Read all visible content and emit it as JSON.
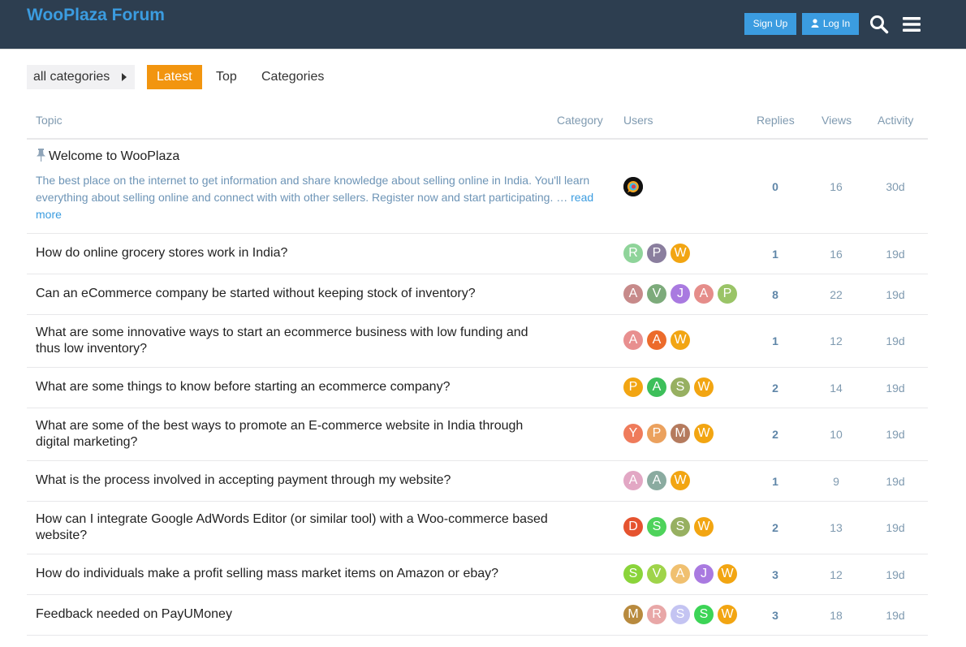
{
  "header": {
    "logo": "WooPlaza Forum",
    "signup_label": "Sign Up",
    "login_label": "Log In"
  },
  "nav": {
    "category_dropdown": "all categories",
    "tabs": [
      "Latest",
      "Top",
      "Categories"
    ],
    "active_tab": "Latest"
  },
  "table": {
    "headers": {
      "topic": "Topic",
      "category": "Category",
      "users": "Users",
      "replies": "Replies",
      "views": "Views",
      "activity": "Activity"
    },
    "pinned": {
      "title": "Welcome to WooPlaza",
      "excerpt": "The best place on the internet to get information and share knowledge about selling online in India. You'll learn everything about selling online and connect with with other sellers. Register now and start participating. …",
      "read_more": "read more",
      "replies": "0",
      "views": "16",
      "activity": "30d"
    },
    "rows": [
      {
        "title": "How do online grocery stores work in India?",
        "avatars": [
          {
            "l": "R",
            "c": "#8fd49a"
          },
          {
            "l": "P",
            "c": "#8a7e9e"
          },
          {
            "l": "W",
            "c": "#f2a512"
          }
        ],
        "replies": "1",
        "views": "16",
        "activity": "19d"
      },
      {
        "title": "Can an eCommerce company be started without keeping stock of inventory?",
        "avatars": [
          {
            "l": "A",
            "c": "#c78a8a"
          },
          {
            "l": "V",
            "c": "#7dab7b"
          },
          {
            "l": "J",
            "c": "#a97ae0"
          },
          {
            "l": "A",
            "c": "#e58d8a"
          },
          {
            "l": "P",
            "c": "#9ac467"
          }
        ],
        "replies": "8",
        "views": "22",
        "activity": "19d"
      },
      {
        "title": "What are some innovative ways to start an ecommerce business with low funding and thus low inventory?",
        "avatars": [
          {
            "l": "A",
            "c": "#e88f8f"
          },
          {
            "l": "A",
            "c": "#ec6b2b"
          },
          {
            "l": "W",
            "c": "#f2a512"
          }
        ],
        "replies": "1",
        "views": "12",
        "activity": "19d"
      },
      {
        "title": "What are some things to know before starting an ecommerce company?",
        "avatars": [
          {
            "l": "P",
            "c": "#f2a512"
          },
          {
            "l": "A",
            "c": "#3dbf5a"
          },
          {
            "l": "S",
            "c": "#97b061"
          },
          {
            "l": "W",
            "c": "#f2a512"
          }
        ],
        "replies": "2",
        "views": "14",
        "activity": "19d"
      },
      {
        "title": "What are some of the best ways to promote an E-commerce website in India through digital marketing?",
        "avatars": [
          {
            "l": "Y",
            "c": "#ef7b5b"
          },
          {
            "l": "P",
            "c": "#eba15e"
          },
          {
            "l": "M",
            "c": "#b57b5e"
          },
          {
            "l": "W",
            "c": "#f2a512"
          }
        ],
        "replies": "2",
        "views": "10",
        "activity": "19d"
      },
      {
        "title": "What is the process involved in accepting payment through my website?",
        "avatars": [
          {
            "l": "A",
            "c": "#e2a7c4"
          },
          {
            "l": "A",
            "c": "#8aaba0"
          },
          {
            "l": "W",
            "c": "#f2a512"
          }
        ],
        "replies": "1",
        "views": "9",
        "activity": "19d"
      },
      {
        "title": "How can I integrate Google AdWords Editor (or similar tool) with a Woo-commerce based website?",
        "avatars": [
          {
            "l": "D",
            "c": "#e5532f"
          },
          {
            "l": "S",
            "c": "#4ed35b"
          },
          {
            "l": "S",
            "c": "#97b061"
          },
          {
            "l": "W",
            "c": "#f2a512"
          }
        ],
        "replies": "2",
        "views": "13",
        "activity": "19d"
      },
      {
        "title": "How do individuals make a profit selling mass market items on Amazon or ebay?",
        "avatars": [
          {
            "l": "S",
            "c": "#8ad43a"
          },
          {
            "l": "V",
            "c": "#9fd44a"
          },
          {
            "l": "A",
            "c": "#f0c070"
          },
          {
            "l": "J",
            "c": "#a97ae0"
          },
          {
            "l": "W",
            "c": "#f2a512"
          }
        ],
        "replies": "3",
        "views": "12",
        "activity": "19d"
      },
      {
        "title": "Feedback needed on PayUMoney",
        "avatars": [
          {
            "l": "M",
            "c": "#b88a3e"
          },
          {
            "l": "R",
            "c": "#e8a7a7"
          },
          {
            "l": "S",
            "c": "#c4c4f2"
          },
          {
            "l": "S",
            "c": "#3cd456"
          },
          {
            "l": "W",
            "c": "#f2a512"
          }
        ],
        "replies": "3",
        "views": "18",
        "activity": "19d"
      }
    ]
  },
  "colors": {
    "header_bg": "#2d3e50",
    "accent": "#3b9ce0",
    "active_tab": "#f2950f"
  }
}
